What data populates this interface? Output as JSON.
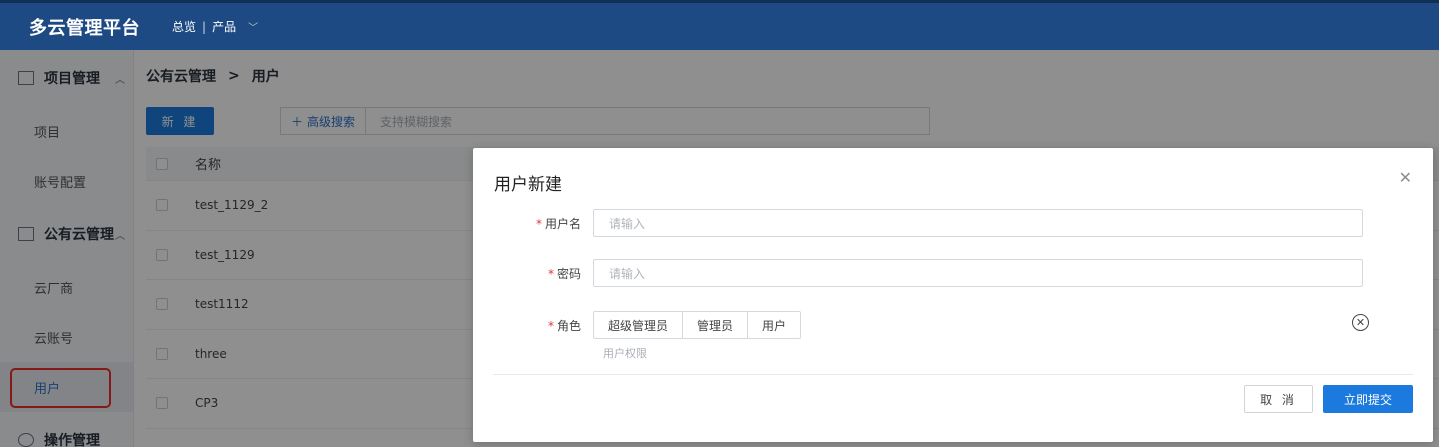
{
  "app": {
    "title": "多云管理平台"
  },
  "topnav": {
    "overview": "总览",
    "separator": "|",
    "products": "产品"
  },
  "sidebar": {
    "groups": [
      {
        "label": "项目管理",
        "items": [
          "项目",
          "账号配置"
        ]
      },
      {
        "label": "公有云管理",
        "items": [
          "云厂商",
          "云账号",
          "用户"
        ]
      },
      {
        "label": "操作管理",
        "items": []
      }
    ],
    "active_item": "用户"
  },
  "breadcrumb": {
    "parent": "公有云管理",
    "separator": ">",
    "current": "用户"
  },
  "toolbar": {
    "new_label": "新 建",
    "advanced_search": "高级搜索",
    "search_placeholder": "支持模糊搜索"
  },
  "table": {
    "columns": [
      "名称"
    ],
    "rows": [
      "test_1129_2",
      "test_1129",
      "test1112",
      "three",
      "CP3"
    ]
  },
  "modal": {
    "title": "用户新建",
    "username_label": "用户名",
    "username_placeholder": "请输入",
    "password_label": "密码",
    "password_placeholder": "请输入",
    "role_label": "角色",
    "roles": [
      "超级管理员",
      "管理员",
      "用户"
    ],
    "role_hint": "用户权限",
    "cancel_label": "取 消",
    "submit_label": "立即提交"
  },
  "colors": {
    "header": "#1d4a82",
    "primary": "#1c7adf",
    "highlight": "#ef2c2c"
  }
}
